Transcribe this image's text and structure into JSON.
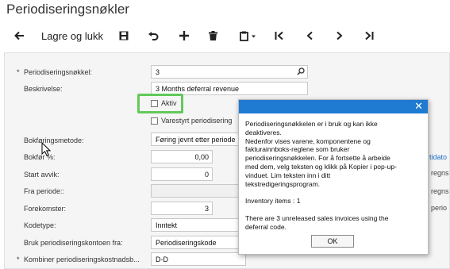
{
  "page": {
    "title": "Periodiseringsnøkler"
  },
  "toolbar": {
    "back_icon": "arrow-left-icon",
    "save_close_label": "Lagre og lukk",
    "save_icon": "floppy-disk-icon",
    "undo_icon": "undo-icon",
    "add_icon": "plus-icon",
    "delete_icon": "trash-icon",
    "copy_paste_icon": "clipboard-icon",
    "first_icon": "skip-first-icon",
    "prev_icon": "chevron-left-icon",
    "next_icon": "chevron-right-icon",
    "last_icon": "skip-last-icon"
  },
  "form": {
    "key": {
      "label": "Periodiseringsnøkkel:",
      "value": "3"
    },
    "description": {
      "label": "Beskrivelse:",
      "value": "3 Months deferral  revenue"
    },
    "active": {
      "label": "Aktiv",
      "checked": false
    },
    "varestyrt": {
      "label": "Varestyrt periodisering"
    },
    "method": {
      "label": "Bokføringsmetode:",
      "value": "Føring jevnt etter periode"
    },
    "bokfor_pct": {
      "label": "Bokfør %:",
      "value": "0,00"
    },
    "start_offset": {
      "label": "Start avvik:",
      "value": "0"
    },
    "from_period": {
      "label": "Fra periode::",
      "value": ""
    },
    "occurrences": {
      "label": "Forekomster:",
      "value": "3"
    },
    "code_type": {
      "label": "Kodetype:",
      "value": "Inntekt"
    },
    "use_account_from": {
      "label": "Bruk periodiseringskontoen fra:",
      "value": "Periodiseringskode"
    },
    "combine_sub": {
      "label": "Kombiner periodiseringskostnadsb...",
      "value": "D-D"
    },
    "required_mark": "*"
  },
  "right_fragments": {
    "f1": "tidato",
    "f2": "regns",
    "f3": "regns",
    "f4": "perio"
  },
  "dialog": {
    "close_icon": "close-icon",
    "lines": [
      "Periodiseringsnøkkelen er i bruk og kan ikke",
      "deaktiveres.",
      "Nedenfor vises varene, komponentene og",
      "fakturainnboks-reglene som bruker",
      "periodiseringsnøkkelen. For å fortsette å arbeide",
      "med dem, velg teksten og klikk på Kopier i pop-up-",
      "vinduet. Lim teksten inn i ditt",
      "tekstredigeringsprogram.",
      "",
      "Inventory items : 1",
      "",
      "There are 3 unreleased sales invoices using the",
      "deferral code."
    ],
    "ok_label": "OK"
  }
}
